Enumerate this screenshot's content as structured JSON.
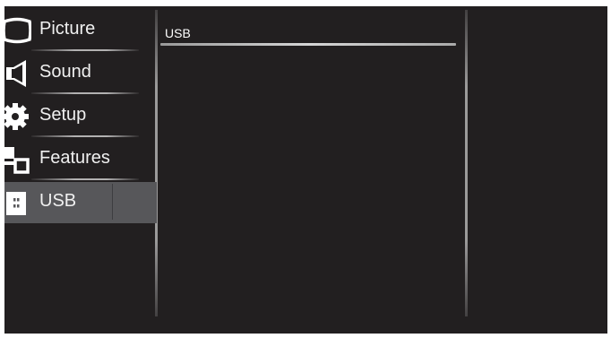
{
  "main_menu": {
    "items": [
      {
        "label": "Picture",
        "icon": "monitor-icon"
      },
      {
        "label": "Sound",
        "icon": "speaker-icon"
      },
      {
        "label": "Setup",
        "icon": "gear-icon"
      },
      {
        "label": "Features",
        "icon": "features-icon"
      },
      {
        "label": "USB",
        "icon": "usb-icon",
        "selected": true
      }
    ]
  },
  "submenu": {
    "items": [
      {
        "label": "USB"
      }
    ]
  },
  "colors": {
    "background": "#221f20",
    "selected_item": "#57575a",
    "text": "#f0f0f0"
  }
}
